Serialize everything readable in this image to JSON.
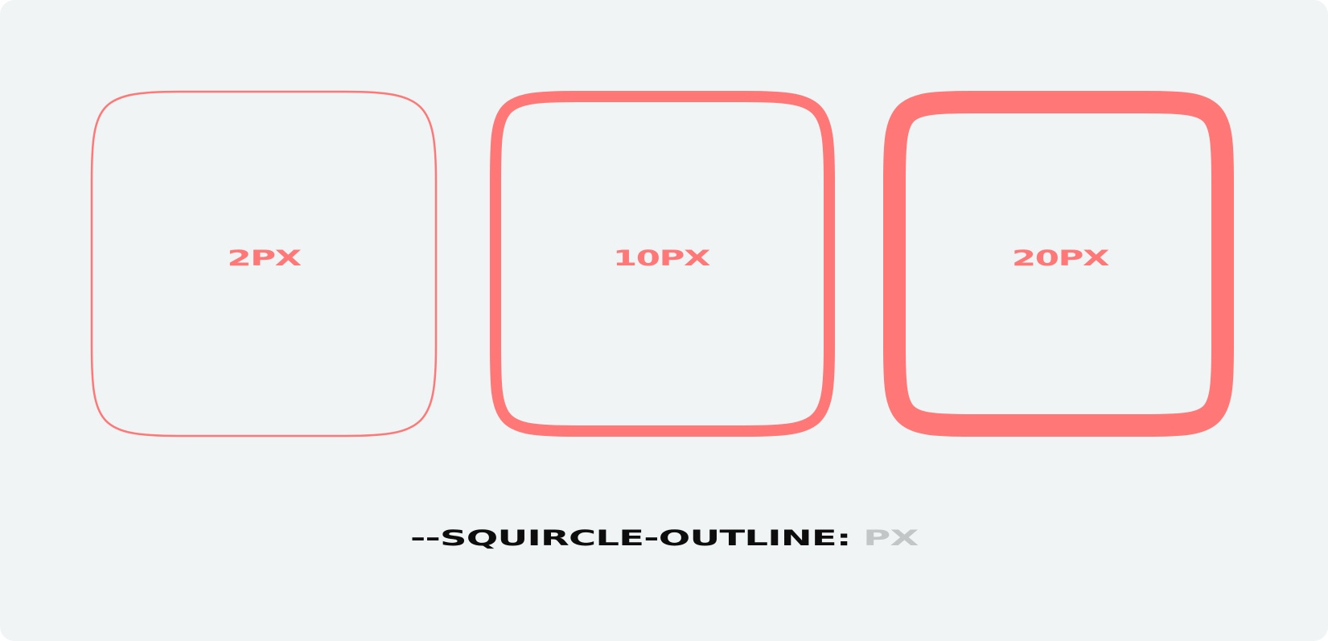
{
  "colors": {
    "background": "#f0f4f4",
    "outline": "#ff7777",
    "caption_text": "#0d0d0d",
    "caption_unit": "#c2c6c6"
  },
  "squircles": [
    {
      "label": "2PX",
      "stroke_px": 2
    },
    {
      "label": "10PX",
      "stroke_px": 10
    },
    {
      "label": "20PX",
      "stroke_px": 20
    }
  ],
  "caption": {
    "property": "--SQUIRCLE-OUTLINE:",
    "unit": "PX"
  }
}
